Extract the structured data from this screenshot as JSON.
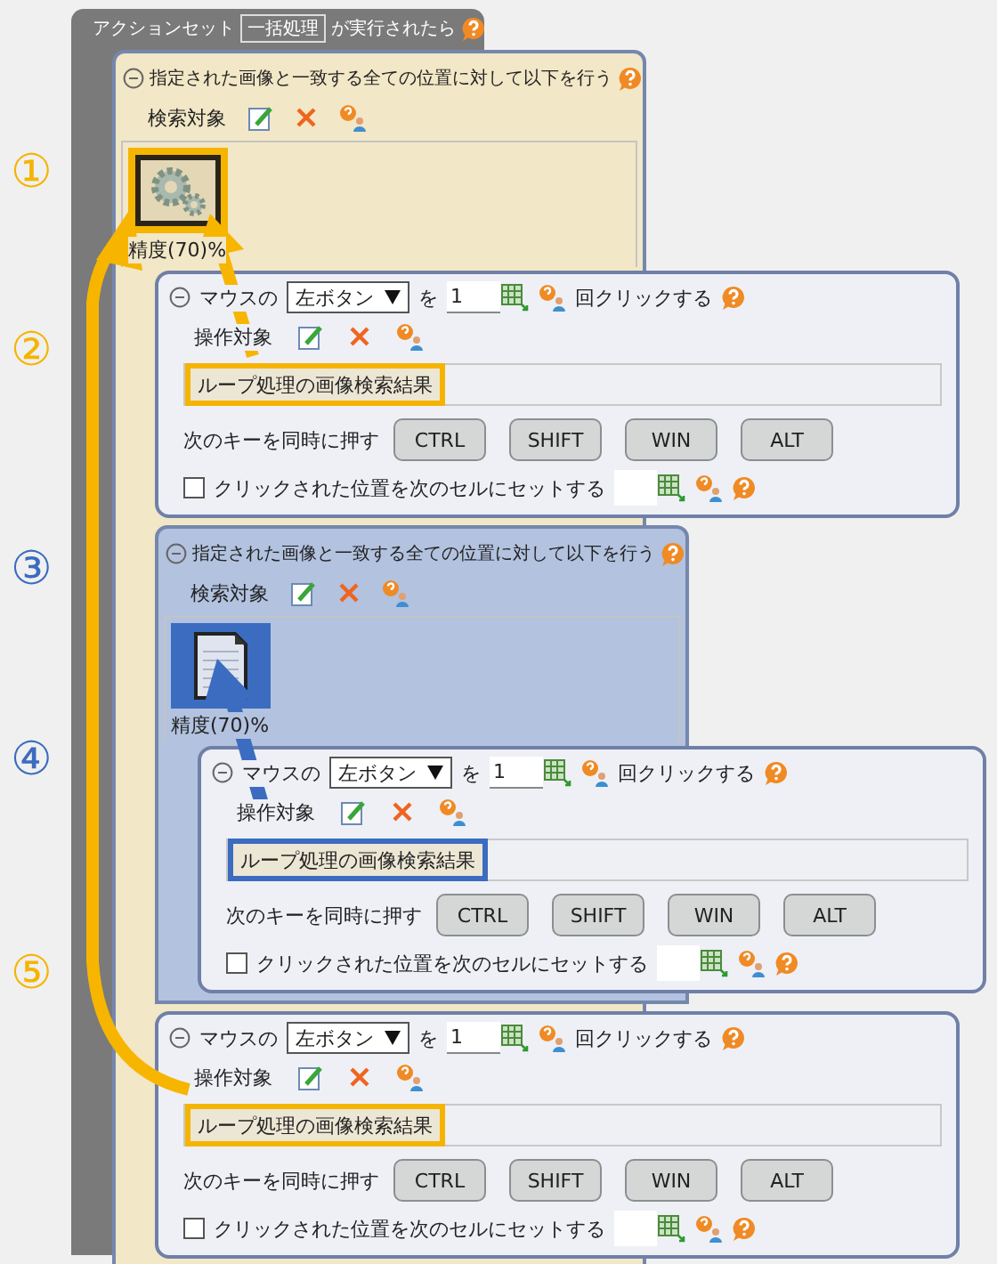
{
  "step_markers": [
    {
      "label": "①",
      "color": "#f5b400"
    },
    {
      "label": "②",
      "color": "#f5b400"
    },
    {
      "label": "③",
      "color": "#3b6cc0"
    },
    {
      "label": "④",
      "color": "#3b6cc0"
    },
    {
      "label": "⑤",
      "color": "#f5b400"
    }
  ],
  "action_set": {
    "prefix": "アクションセット",
    "name": "一括処理",
    "suffix": "が実行されたら"
  },
  "loop": {
    "kind": "image-loop",
    "color": "#f2e7c6",
    "title": "指定された画像と一致する全ての位置に対して以下を行う",
    "target_label": "検索対象",
    "image": {
      "kind": "gear",
      "color": "#f5b400"
    },
    "accuracy": "精度(70)%",
    "children": [
      {
        "kind": "mouse-click",
        "prefix": "マウスの",
        "button": "左ボタン",
        "particle": "を",
        "count": "1",
        "suffix": "回クリックする",
        "target_label": "操作対象",
        "target": {
          "value": "ループ処理の画像検索結果",
          "color": "#f5b400"
        },
        "keys_label": "次のキーを同時に押す",
        "keys": [
          "CTRL",
          "SHIFT",
          "WIN",
          "ALT"
        ],
        "checkbox": {
          "label": "クリックされた位置を次のセルにセットする",
          "checked": false
        }
      },
      {
        "kind": "image-loop",
        "color": "#b2c2df",
        "title": "指定された画像と一致する全ての位置に対して以下を行う",
        "target_label": "検索対象",
        "image": {
          "kind": "document",
          "color": "#3b6cc0"
        },
        "accuracy": "精度(70)%",
        "children": [
          {
            "kind": "mouse-click",
            "prefix": "マウスの",
            "button": "左ボタン",
            "particle": "を",
            "count": "1",
            "suffix": "回クリックする",
            "target_label": "操作対象",
            "target": {
              "value": "ループ処理の画像検索結果",
              "color": "#3b6cc0"
            },
            "keys_label": "次のキーを同時に押す",
            "keys": [
              "CTRL",
              "SHIFT",
              "WIN",
              "ALT"
            ],
            "checkbox": {
              "label": "クリックされた位置を次のセルにセットする",
              "checked": false
            }
          }
        ]
      },
      {
        "kind": "mouse-click",
        "prefix": "マウスの",
        "button": "左ボタン",
        "particle": "を",
        "count": "1",
        "suffix": "回クリックする",
        "target_label": "操作対象",
        "target": {
          "value": "ループ処理の画像検索結果",
          "color": "#f5b400"
        },
        "keys_label": "次のキーを同時に押す",
        "keys": [
          "CTRL",
          "SHIFT",
          "WIN",
          "ALT"
        ],
        "checkbox": {
          "label": "クリックされた位置を次のセルにセットする",
          "checked": false
        }
      }
    ]
  }
}
